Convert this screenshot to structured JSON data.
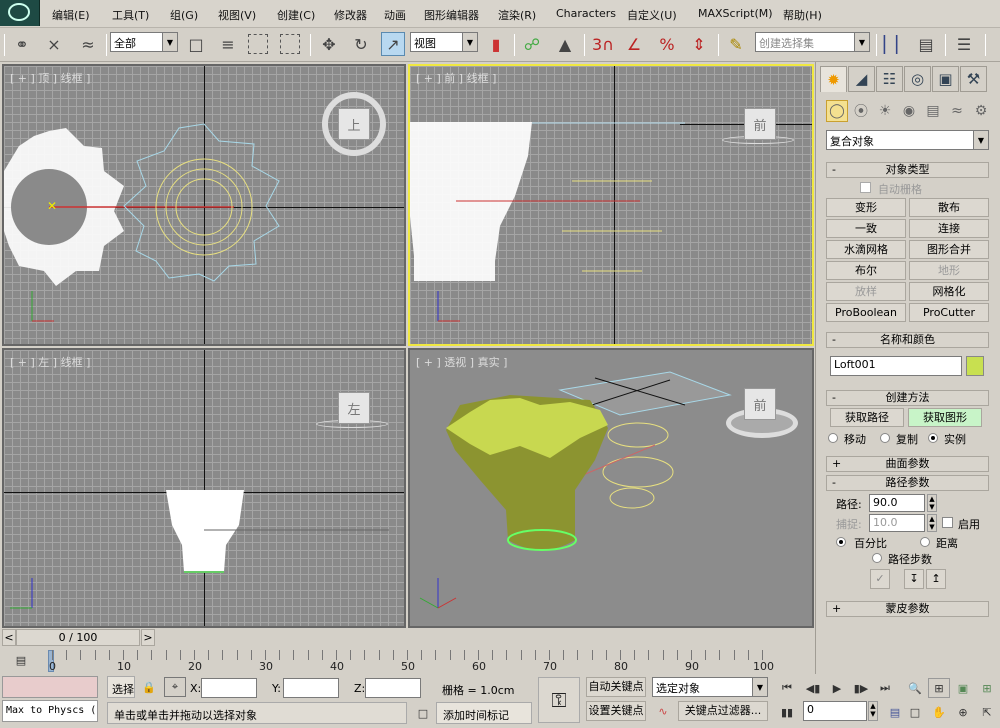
{
  "menubar": {
    "items": [
      "编辑(E)",
      "工具(T)",
      "组(G)",
      "视图(V)",
      "创建(C)",
      "修改器",
      "动画",
      "图形编辑器",
      "渲染(R)",
      "Characters",
      "自定义(U)",
      "MAXScript(M)",
      "帮助(H)"
    ]
  },
  "toolbar": {
    "selection_filter": "全部",
    "reference_coord": "视图",
    "named_selection_placeholder": "创建选择集",
    "icons": {
      "link": "link-icon",
      "unlink": "unlink-icon",
      "bind_space_warp": "bind-space-warp-icon",
      "select_object": "select-object-icon",
      "select_by_name": "select-by-name-icon",
      "rect_region": "rectangle-region-icon",
      "window_crossing": "window-crossing-icon",
      "move": "move-icon",
      "rotate": "rotate-icon",
      "scale": "scale-icon",
      "pivot": "pivot-icon",
      "manipulate": "manipulate-icon",
      "keyboard_shortcut": "keyboard-shortcut-icon",
      "snap": "3",
      "angle_snap": "angle-snap-icon",
      "percent_snap": "%",
      "spinner_snap": "spinner-snap-icon",
      "edit_named_sel": "edit-named-selection-icon",
      "mirror": "mirror-icon",
      "align": "align-icon",
      "layer": "layer-icon"
    }
  },
  "viewports": [
    {
      "label": "[ + ] 顶 ] 线框 ]",
      "cube": "上",
      "name": "top"
    },
    {
      "label": "[ + ] 前 ] 线框 ]",
      "cube": "前",
      "name": "front",
      "active": true
    },
    {
      "label": "[ + ] 左 ] 线框 ]",
      "cube": "左",
      "name": "left"
    },
    {
      "label": "[ + ] 透视 ] 真实 ]",
      "cube": "前",
      "name": "perspective"
    }
  ],
  "command_panel": {
    "tabs": [
      "create",
      "modify",
      "hierarchy",
      "motion",
      "display",
      "utilities"
    ],
    "category": "复合对象",
    "object_type": {
      "title": "对象类型",
      "autogrid_label": "自动栅格",
      "buttons": [
        {
          "label": "变形",
          "enabled": true
        },
        {
          "label": "散布",
          "enabled": true
        },
        {
          "label": "一致",
          "enabled": true
        },
        {
          "label": "连接",
          "enabled": true
        },
        {
          "label": "水滴网格",
          "enabled": true
        },
        {
          "label": "图形合并",
          "enabled": true
        },
        {
          "label": "布尔",
          "enabled": true
        },
        {
          "label": "地形",
          "enabled": false
        },
        {
          "label": "放样",
          "enabled": false
        },
        {
          "label": "网格化",
          "enabled": true
        },
        {
          "label": "ProBoolean",
          "enabled": true
        },
        {
          "label": "ProCutter",
          "enabled": true
        }
      ]
    },
    "name_color": {
      "title": "名称和颜色",
      "name": "Loft001",
      "color": "#c8e050"
    },
    "creation_method": {
      "title": "创建方法",
      "get_path": "获取路径",
      "get_shape": "获取图形",
      "move": "移动",
      "copy": "复制",
      "instance": "实例",
      "selected": "instance"
    },
    "surface_params": {
      "title": "曲面参数"
    },
    "path_params": {
      "title": "路径参数",
      "path_label": "路径:",
      "path_value": "90.0",
      "snap_label": "捕捉:",
      "snap_value": "10.0",
      "enable_label": "启用",
      "percent": "百分比",
      "distance": "距离",
      "path_steps": "路径步数",
      "selected": "percent"
    },
    "skin_params": {
      "title": "蒙皮参数"
    }
  },
  "timeline": {
    "frame_display": "0 / 100",
    "prev": "<",
    "next": ">",
    "ticks": [
      "0",
      "10",
      "20",
      "30",
      "40",
      "50",
      "60",
      "70",
      "80",
      "90",
      "100"
    ],
    "current_frame": 0
  },
  "status": {
    "script_listener": "Max to Physcs (",
    "selection_label": "选择",
    "x_label": "X:",
    "y_label": "Y:",
    "z_label": "Z:",
    "x_value": "",
    "y_value": "",
    "z_value": "",
    "grid": "栅格 = 1.0cm",
    "prompt": "单击或单击并拖动以选择对象",
    "add_time_tag": "添加时间标记",
    "auto_key": "自动关键点",
    "set_key": "设置关键点",
    "key_mode": "选定对象",
    "key_filters": "关键点过滤器...",
    "current_frame": "0"
  }
}
